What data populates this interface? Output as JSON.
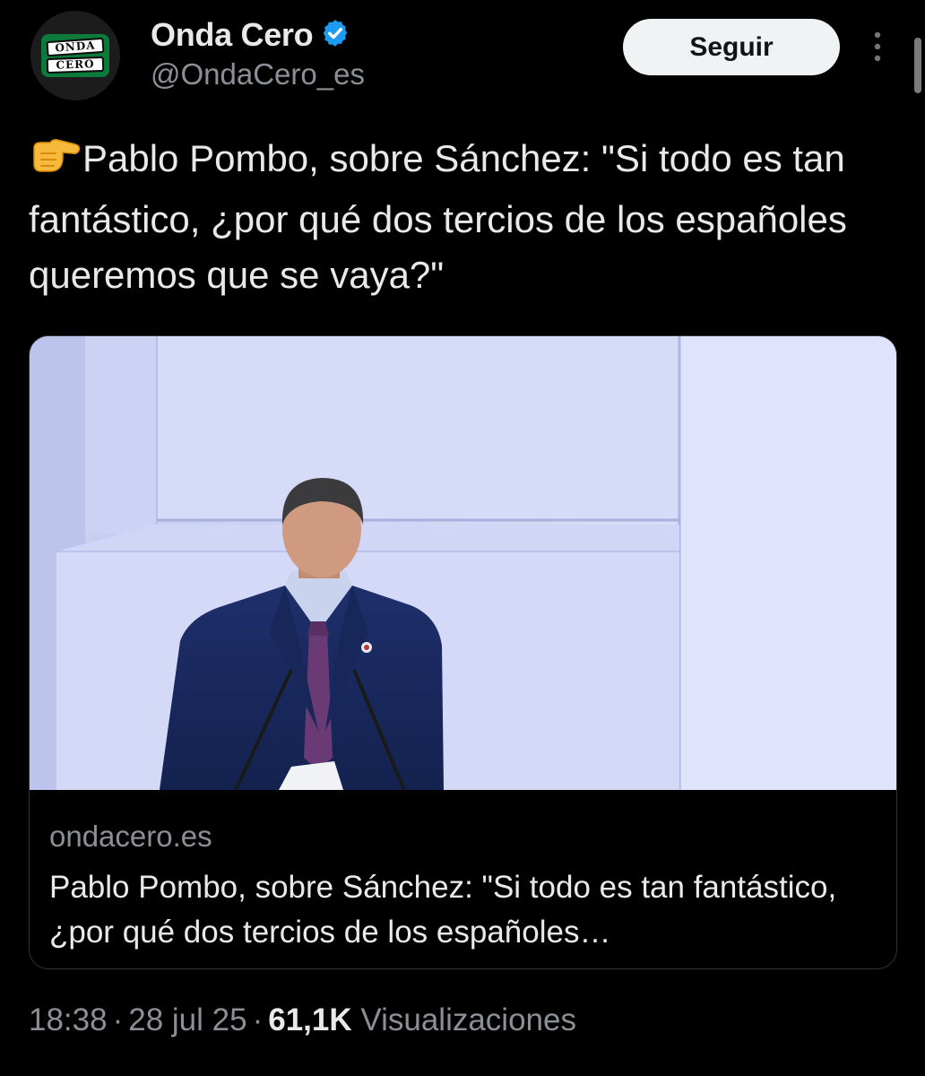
{
  "account": {
    "display_name": "Onda Cero",
    "handle": "@OndaCero_es",
    "verified": true,
    "logo_text": [
      "ONDA",
      "CERO"
    ]
  },
  "actions": {
    "follow_label": "Seguir",
    "more_icon": "more-vertical-icon"
  },
  "tweet": {
    "emoji": "backhand-index-pointing-right",
    "text": "Pablo Pombo, sobre Sánchez: \"Si todo es tan fantástico, ¿por qué dos tercios de los españoles queremos que se vaya?\""
  },
  "card": {
    "domain": "ondacero.es",
    "title": "Pablo Pombo, sobre Sánchez: \"Si todo es tan fantástico, ¿por qué dos tercios de los españoles…"
  },
  "meta": {
    "time": "18:38",
    "date": "28 jul 25",
    "views_count": "61,1K",
    "views_label": "Visualizaciones",
    "separator": "·"
  },
  "colors": {
    "background": "#000000",
    "text_primary": "#e7e9ea",
    "text_secondary": "#8b9096",
    "verified_blue": "#1d9bf0",
    "follow_bg": "#eff3f4",
    "logo_green": "#0b7a3b"
  }
}
